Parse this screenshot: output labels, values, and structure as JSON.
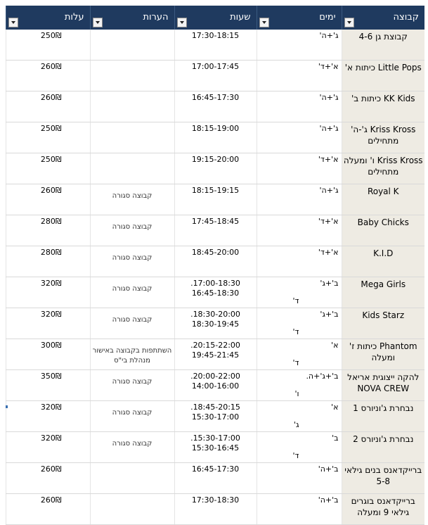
{
  "headers": {
    "group": "קבוצה",
    "days": "ימים",
    "hours": "שעות",
    "notes": "הערות",
    "price": "עלות"
  },
  "rows": [
    {
      "group": "קבוצת גן 4-6",
      "days": "ג'+ה'",
      "days2": "",
      "hours": "17:30-18:15",
      "hours2": "",
      "notes": "",
      "price": "250₪"
    },
    {
      "group": "Little Pops כיתות א'",
      "days": "א'+ד'",
      "days2": "",
      "hours": "17:00-17:45",
      "hours2": "",
      "notes": "",
      "price": "260₪"
    },
    {
      "group": "KK Kids כיתות ב'",
      "days": "ג'+ה'",
      "days2": "",
      "hours": "16:45-17:30",
      "hours2": "",
      "notes": "",
      "price": "260₪"
    },
    {
      "group": "Kriss Kross ג'-ה' מתחילים",
      "days": "ג'+ה'",
      "days2": "",
      "hours": "18:15-19:00",
      "hours2": "",
      "notes": "",
      "price": "250₪"
    },
    {
      "group": "Kriss Kross ו' ומעלה מתחילים",
      "days": "א'+ד'",
      "days2": "",
      "hours": "19:15-20:00",
      "hours2": "",
      "notes": "",
      "price": "250₪"
    },
    {
      "group": "Royal K",
      "days": "ג'+ה'",
      "days2": "",
      "hours": "18:15-19:15",
      "hours2": "",
      "notes": "קבוצה סגורה",
      "price": "260₪"
    },
    {
      "group": "Baby Chicks",
      "days": "א'+ד'",
      "days2": "",
      "hours": "17:45-18:45",
      "hours2": "",
      "notes": "קבוצה סגורה",
      "price": "280₪"
    },
    {
      "group": "K.I.D",
      "days": "א'+ד'",
      "days2": "",
      "hours": "18:45-20:00",
      "hours2": "",
      "notes": "קבוצה סגורה",
      "price": "280₪"
    },
    {
      "group": "Mega Girls",
      "days": "ב'+ג'",
      "days2": "ד'",
      "hours": "17:00-18:30.",
      "hours2": "16:45-18:30",
      "notes": "קבוצה סגורה",
      "price": "320₪"
    },
    {
      "group": "Kids Starz",
      "days": "ב'+ג'",
      "days2": "ד'",
      "hours": "18:30-20:00.",
      "hours2": "18:30-19:45",
      "notes": "קבוצה סגורה",
      "price": "320₪"
    },
    {
      "group": "Phantom כיתות ז' ומעלה",
      "days": "א'",
      "days2": "ד'",
      "hours": "20:15-22:00.",
      "hours2": "19:45-21:45",
      "notes": "השתתפות בקבוצה באישור מנהלת בי\"ס",
      "price": "300₪"
    },
    {
      "group": "להקה ייצוגית אריאל NOVA CREW",
      "days": "ב'+ג'+ה.",
      "days2": "ו'",
      "hours": "20:00-22:00.",
      "hours2": "14:00-16:00",
      "notes": "קבוצה סגורה",
      "price": "350₪"
    },
    {
      "group": "נבחרת ג'וניורס 1",
      "days": "א'",
      "days2": "ג'",
      "hours": "18:45-20:15.",
      "hours2": "15:30-17:00",
      "notes": "קבוצה סגורה",
      "price": "320₪"
    },
    {
      "group": "נבחרת ג'וניורס 2",
      "days": "ב'",
      "days2": "ד'",
      "hours": "15:30-17:00.",
      "hours2": "15:30-16:45",
      "notes": "קבוצה סגורה",
      "price": "320₪"
    },
    {
      "group": "ברייקדאנס בנים גילאי 5-8",
      "days": "ב'+ה'",
      "days2": "",
      "hours": "16:45-17:30",
      "hours2": "",
      "notes": "",
      "price": "260₪"
    },
    {
      "group": "ברייקדאנס בוגרים גילאי 9 ומעלה",
      "days": "ב'+ה'",
      "days2": "",
      "hours": "17:30-18:30",
      "hours2": "",
      "notes": "",
      "price": "260₪"
    }
  ]
}
